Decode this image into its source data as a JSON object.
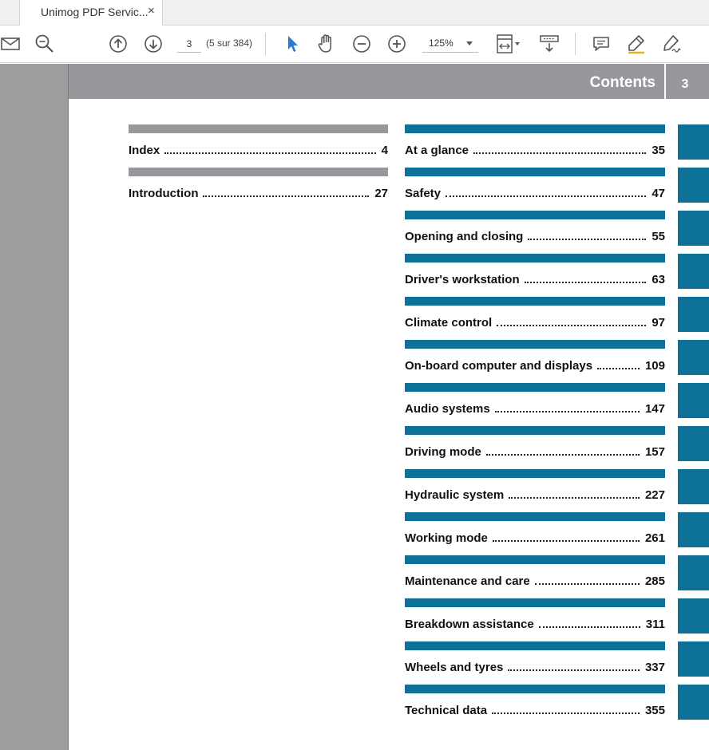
{
  "browser": {
    "tab_title": "Unimog PDF Servic...",
    "tab_close": "×"
  },
  "toolbar": {
    "page_current": "3",
    "page_count": "(5 sur 384)",
    "zoom": "125%",
    "icons": [
      "mail-icon",
      "search-zoom-icon",
      "arrow-up-circle-icon",
      "arrow-down-circle-icon",
      "select-cursor-icon",
      "hand-tool-icon",
      "zoom-out-icon",
      "zoom-in-icon",
      "fit-page-icon",
      "scroll-mode-icon",
      "comment-icon",
      "highlight-pen-icon",
      "sign-icon"
    ]
  },
  "page": {
    "header_title": "Contents",
    "page_number": "3",
    "colors": {
      "header_gray": "#96989b",
      "left_bar_gray": "#96989b",
      "accent_teal": "#0e7197"
    },
    "left_column": [
      {
        "label": "Index",
        "page": "4"
      },
      {
        "label": "Introduction",
        "page": "27"
      }
    ],
    "right_column": [
      {
        "label": "At a glance",
        "page": "35"
      },
      {
        "label": "Safety",
        "page": "47"
      },
      {
        "label": "Opening and closing",
        "page": "55"
      },
      {
        "label": "Driver's workstation",
        "page": "63"
      },
      {
        "label": "Climate control",
        "page": "97"
      },
      {
        "label": "On-board computer and displays",
        "page": "109"
      },
      {
        "label": "Audio systems",
        "page": "147"
      },
      {
        "label": "Driving mode",
        "page": "157"
      },
      {
        "label": "Hydraulic system",
        "page": "227"
      },
      {
        "label": "Working mode",
        "page": "261"
      },
      {
        "label": "Maintenance and care",
        "page": "285"
      },
      {
        "label": "Breakdown assistance",
        "page": "311"
      },
      {
        "label": "Wheels and tyres",
        "page": "337"
      },
      {
        "label": "Technical data",
        "page": "355"
      }
    ]
  }
}
